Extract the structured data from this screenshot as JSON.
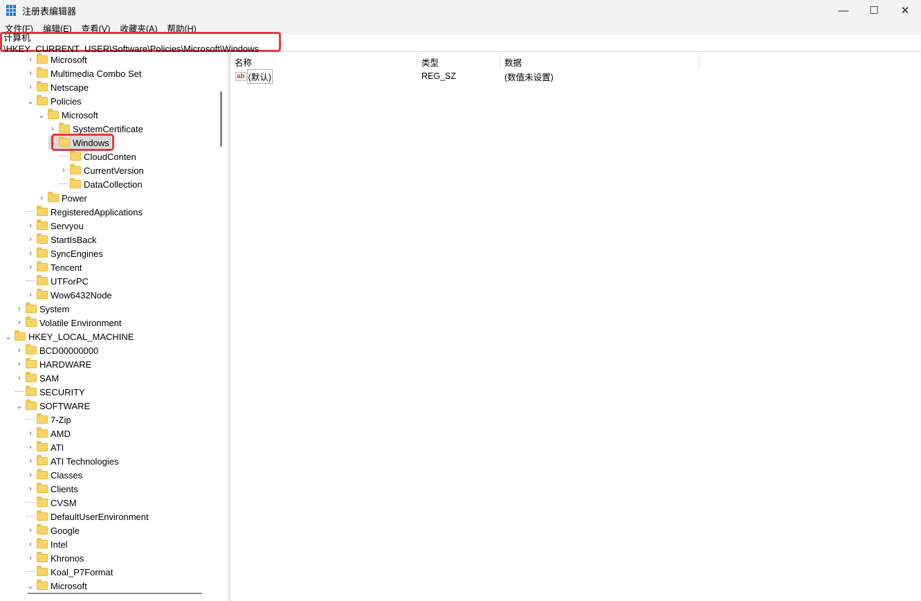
{
  "window": {
    "title": "注册表编辑器",
    "icon": "regedit-icon",
    "minimize": "—",
    "maximize": "☐",
    "close": "✕"
  },
  "menu": [
    "文件(F)",
    "编辑(E)",
    "查看(V)",
    "收藏夹(A)",
    "帮助(H)"
  ],
  "address": "计算机\\HKEY_CURRENT_USER\\Software\\Policies\\Microsoft\\Windows",
  "tree": [
    {
      "label": "Microsoft",
      "level": 2,
      "exp": ">"
    },
    {
      "label": "Multimedia Combo Set",
      "level": 2,
      "exp": ">"
    },
    {
      "label": "Netscape",
      "level": 2,
      "exp": ">"
    },
    {
      "label": "Policies",
      "level": 2,
      "exp": "v"
    },
    {
      "label": "Microsoft",
      "level": 3,
      "exp": "v"
    },
    {
      "label": "SystemCertificate",
      "level": 4,
      "exp": ">"
    },
    {
      "label": "Windows",
      "level": 4,
      "exp": "v",
      "selected": true
    },
    {
      "label": "CloudConten",
      "level": 5,
      "exp": ""
    },
    {
      "label": "CurrentVersion",
      "level": 5,
      "exp": ">"
    },
    {
      "label": "DataCollection",
      "level": 5,
      "exp": ""
    },
    {
      "label": "Power",
      "level": 3,
      "exp": ">"
    },
    {
      "label": "RegisteredApplications",
      "level": 2,
      "exp": ""
    },
    {
      "label": "Servyou",
      "level": 2,
      "exp": ">"
    },
    {
      "label": "StartIsBack",
      "level": 2,
      "exp": ">"
    },
    {
      "label": "SyncEngines",
      "level": 2,
      "exp": ">"
    },
    {
      "label": "Tencent",
      "level": 2,
      "exp": ">"
    },
    {
      "label": "UTForPC",
      "level": 2,
      "exp": ""
    },
    {
      "label": "Wow6432Node",
      "level": 2,
      "exp": ">"
    },
    {
      "label": "System",
      "level": 1,
      "exp": ">"
    },
    {
      "label": "Volatile Environment",
      "level": 1,
      "exp": ">"
    },
    {
      "label": "HKEY_LOCAL_MACHINE",
      "level": 0,
      "exp": "v"
    },
    {
      "label": "BCD00000000",
      "level": 1,
      "exp": ">"
    },
    {
      "label": "HARDWARE",
      "level": 1,
      "exp": ">"
    },
    {
      "label": "SAM",
      "level": 1,
      "exp": ">"
    },
    {
      "label": "SECURITY",
      "level": 1,
      "exp": ""
    },
    {
      "label": "SOFTWARE",
      "level": 1,
      "exp": "v"
    },
    {
      "label": "7-Zip",
      "level": 2,
      "exp": ""
    },
    {
      "label": "AMD",
      "level": 2,
      "exp": ">"
    },
    {
      "label": "ATI",
      "level": 2,
      "exp": ">"
    },
    {
      "label": "ATI Technologies",
      "level": 2,
      "exp": ">"
    },
    {
      "label": "Classes",
      "level": 2,
      "exp": ">"
    },
    {
      "label": "Clients",
      "level": 2,
      "exp": ">"
    },
    {
      "label": "CVSM",
      "level": 2,
      "exp": ""
    },
    {
      "label": "DefaultUserEnvironment",
      "level": 2,
      "exp": ""
    },
    {
      "label": "Google",
      "level": 2,
      "exp": ">"
    },
    {
      "label": "Intel",
      "level": 2,
      "exp": ">"
    },
    {
      "label": "Khronos",
      "level": 2,
      "exp": ">"
    },
    {
      "label": "Koal_P7Format",
      "level": 2,
      "exp": ""
    },
    {
      "label": "Microsoft",
      "level": 2,
      "exp": "v"
    }
  ],
  "list": {
    "columns": [
      "名称",
      "类型",
      "数据"
    ],
    "rows": [
      {
        "icon": "ab",
        "name": "(默认)",
        "type": "REG_SZ",
        "data": "(数值未设置)"
      }
    ]
  }
}
